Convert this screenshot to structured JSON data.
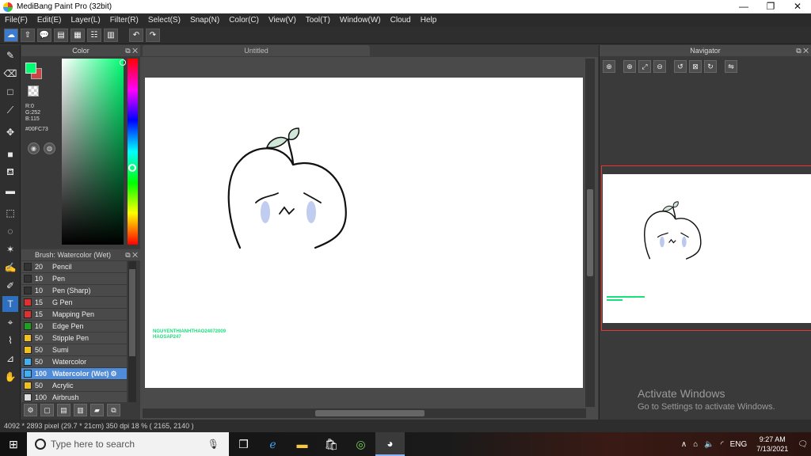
{
  "window": {
    "title": "MediBang Paint Pro (32bit)",
    "minimize": "—",
    "restore": "❐",
    "close": "✕"
  },
  "menu": [
    "File(F)",
    "Edit(E)",
    "Layer(L)",
    "Filter(R)",
    "Select(S)",
    "Snap(N)",
    "Color(C)",
    "View(V)",
    "Tool(T)",
    "Window(W)",
    "Cloud",
    "Help"
  ],
  "toolbar": {
    "cloud": "☁",
    "upload": "⇧",
    "comment": "💬",
    "page": "▤",
    "doc": "▦",
    "list": "☷",
    "grid": "▥",
    "undo": "↶",
    "redo": "↷"
  },
  "tools": {
    "brush": "✎",
    "eraser": "⌫",
    "rect": "□",
    "line": "⟋",
    "move": "✥",
    "fill_rect": "■",
    "bucket": "⛾",
    "gradient": "▬",
    "select_rect": "⬚",
    "lasso": "◌",
    "magic_wand": "✶",
    "select_pen": "✍",
    "select_eraser": "✐",
    "text": "T",
    "operation": "⌖",
    "eyedropper": "⌇",
    "dropper2": "⊿",
    "hand": "✋"
  },
  "color_panel": {
    "title": "Color",
    "r": "R:0",
    "g": "G:252",
    "b": "B:115",
    "hex": "#00FC73",
    "fg_color": "#00FC73"
  },
  "brush_panel": {
    "title": "Brush: Watercolor (Wet)",
    "items": [
      {
        "size": "20",
        "name": "Pencil",
        "color": "#333333"
      },
      {
        "size": "10",
        "name": "Pen",
        "color": "#333333"
      },
      {
        "size": "10",
        "name": "Pen (Sharp)",
        "color": "#333333"
      },
      {
        "size": "15",
        "name": "G Pen",
        "color": "#e03030"
      },
      {
        "size": "15",
        "name": "Mapping Pen",
        "color": "#e03030"
      },
      {
        "size": "10",
        "name": "Edge Pen",
        "color": "#20a020"
      },
      {
        "size": "50",
        "name": "Stipple Pen",
        "color": "#f0c020"
      },
      {
        "size": "50",
        "name": "Sumi",
        "color": "#f0c020"
      },
      {
        "size": "50",
        "name": "Watercolor",
        "color": "#40b0f0"
      },
      {
        "size": "100",
        "name": "Watercolor (Wet)",
        "color": "#40b0f0",
        "selected": true
      },
      {
        "size": "50",
        "name": "Acrylic",
        "color": "#f0c020"
      },
      {
        "size": "100",
        "name": "Airbrush",
        "color": "#dddddd"
      }
    ]
  },
  "document": {
    "tab": "Untitled",
    "signature_line1": "NGUYENTHIANHTHAO24072009",
    "signature_line2": "HAOSAP247"
  },
  "navigator": {
    "title": "Navigator"
  },
  "watermark": {
    "line1": "Activate Windows",
    "line2": "Go to Settings to activate Windows."
  },
  "status": "4092 * 2893 pixel  (29.7 * 21cm)  350 dpi  18 %  ( 2165, 2140 )",
  "taskbar": {
    "search_placeholder": "Type here to search",
    "lang": "ENG",
    "time": "9:27 AM",
    "date": "7/13/2021"
  }
}
